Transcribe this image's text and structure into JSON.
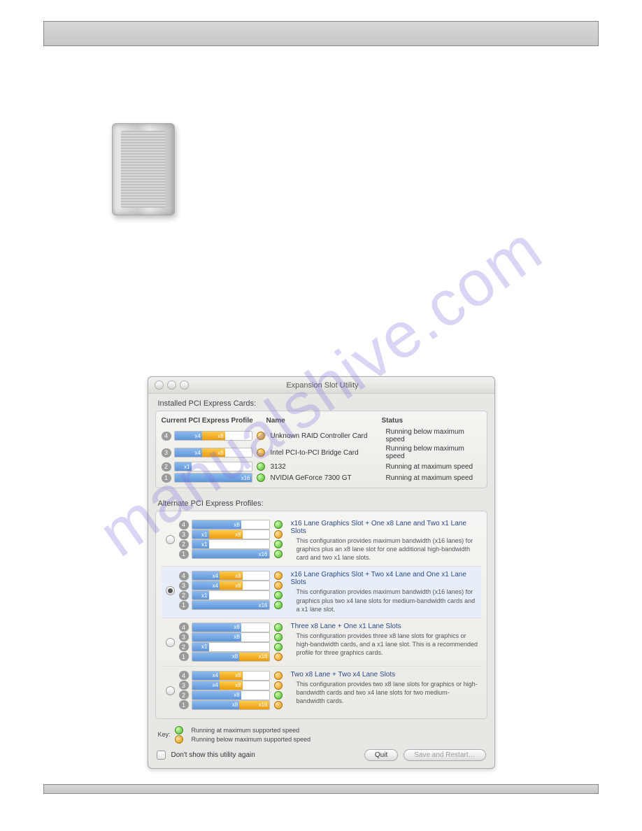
{
  "watermark": "manualshive.com",
  "app": {
    "title": "Expansion Slot Utility",
    "section_installed": "Installed PCI Express Cards:",
    "section_alternate": "Alternate PCI Express Profiles:",
    "headers": {
      "profile": "Current PCI Express Profile",
      "name": "Name",
      "status": "Status"
    },
    "installed": [
      {
        "slot": "4",
        "segs": [
          {
            "w": 34,
            "c": "blue",
            "t": "x4"
          },
          {
            "w": 28,
            "c": "oran",
            "t": "x8"
          }
        ],
        "dot": "o",
        "name": "Unknown RAID Controller Card",
        "status": "Running below maximum speed"
      },
      {
        "slot": "3",
        "segs": [
          {
            "w": 34,
            "c": "blue",
            "t": "x4"
          },
          {
            "w": 28,
            "c": "oran",
            "t": "x8"
          }
        ],
        "dot": "o",
        "name": "Intel PCI-to-PCI Bridge Card",
        "status": "Running below maximum speed"
      },
      {
        "slot": "2",
        "segs": [
          {
            "w": 20,
            "c": "blue",
            "t": "x1"
          }
        ],
        "dot": "g",
        "name": "3132",
        "status": "Running at maximum speed"
      },
      {
        "slot": "1",
        "segs": [
          {
            "w": 100,
            "c": "blue",
            "t": "x16"
          }
        ],
        "dot": "g",
        "name": "NVIDIA GeForce 7300 GT",
        "status": "Running at maximum speed"
      }
    ],
    "profiles": [
      {
        "selected": false,
        "title": "x16 Lane Graphics Slot + One x8 Lane and Two x1 Lane Slots",
        "body": "This configuration provides maximum bandwidth (x16 lanes) for graphics plus an x8 lane slot for one additional high-bandwidth card and two x1 lane slots.",
        "rows": [
          {
            "slot": "4",
            "segs": [
              {
                "w": 62,
                "c": "blue",
                "t": "x8"
              }
            ],
            "dot": "g"
          },
          {
            "slot": "3",
            "segs": [
              {
                "w": 20,
                "c": "blue",
                "t": "x1"
              },
              {
                "w": 42,
                "c": "oran",
                "t": "x8"
              }
            ],
            "dot": "o"
          },
          {
            "slot": "2",
            "segs": [
              {
                "w": 20,
                "c": "blue",
                "t": "x1"
              }
            ],
            "dot": "g"
          },
          {
            "slot": "1",
            "segs": [
              {
                "w": 100,
                "c": "blue",
                "t": "x16"
              }
            ],
            "dot": "g"
          }
        ]
      },
      {
        "selected": true,
        "title": "x16 Lane Graphics Slot + Two x4 Lane and One x1 Lane Slots",
        "body": "This configuration provides maximum bandwidth (x16 lanes) for graphics plus two x4 lane slots for medium-bandwidth cards and a x1 lane slot.",
        "rows": [
          {
            "slot": "4",
            "segs": [
              {
                "w": 34,
                "c": "blue",
                "t": "x4"
              },
              {
                "w": 28,
                "c": "oran",
                "t": "x8"
              }
            ],
            "dot": "o"
          },
          {
            "slot": "3",
            "segs": [
              {
                "w": 34,
                "c": "blue",
                "t": "x4"
              },
              {
                "w": 28,
                "c": "oran",
                "t": "x8"
              }
            ],
            "dot": "o"
          },
          {
            "slot": "2",
            "segs": [
              {
                "w": 20,
                "c": "blue",
                "t": "x1"
              }
            ],
            "dot": "g"
          },
          {
            "slot": "1",
            "segs": [
              {
                "w": 100,
                "c": "blue",
                "t": "x16"
              }
            ],
            "dot": "g"
          }
        ]
      },
      {
        "selected": false,
        "title": "Three x8 Lane + One x1 Lane Slots",
        "body": "This configuration provides three x8 lane slots for graphics or high-bandwidth cards, and a x1 lane slot. This is a recommended profile for three graphics cards.",
        "rows": [
          {
            "slot": "4",
            "segs": [
              {
                "w": 62,
                "c": "blue",
                "t": "x8"
              }
            ],
            "dot": "g"
          },
          {
            "slot": "3",
            "segs": [
              {
                "w": 62,
                "c": "blue",
                "t": "x8"
              }
            ],
            "dot": "g"
          },
          {
            "slot": "2",
            "segs": [
              {
                "w": 20,
                "c": "blue",
                "t": "x1"
              }
            ],
            "dot": "g"
          },
          {
            "slot": "1",
            "segs": [
              {
                "w": 62,
                "c": "blue",
                "t": "x8"
              },
              {
                "w": 38,
                "c": "oran",
                "t": "x16"
              }
            ],
            "dot": "o"
          }
        ]
      },
      {
        "selected": false,
        "title": "Two x8 Lane + Two x4 Lane Slots",
        "body": "This configuration provides two x8 lane slots for graphics or high-bandwidth cards and two x4 lane slots for two medium-bandwidth cards.",
        "rows": [
          {
            "slot": "4",
            "segs": [
              {
                "w": 34,
                "c": "blue",
                "t": "x4"
              },
              {
                "w": 28,
                "c": "oran",
                "t": "x8"
              }
            ],
            "dot": "o"
          },
          {
            "slot": "3",
            "segs": [
              {
                "w": 34,
                "c": "blue",
                "t": "x4"
              },
              {
                "w": 28,
                "c": "oran",
                "t": "x8"
              }
            ],
            "dot": "o"
          },
          {
            "slot": "2",
            "segs": [
              {
                "w": 62,
                "c": "blue",
                "t": "x8"
              }
            ],
            "dot": "g"
          },
          {
            "slot": "1",
            "segs": [
              {
                "w": 62,
                "c": "blue",
                "t": "x8"
              },
              {
                "w": 38,
                "c": "oran",
                "t": "x16"
              }
            ],
            "dot": "o"
          }
        ]
      }
    ],
    "key_label": "Key:",
    "key_green": "Running at maximum supported speed",
    "key_orange": "Running below maximum supported speed",
    "dont_show": "Don't show this utility again",
    "btn_quit": "Quit",
    "btn_save": "Save and Restart…"
  }
}
